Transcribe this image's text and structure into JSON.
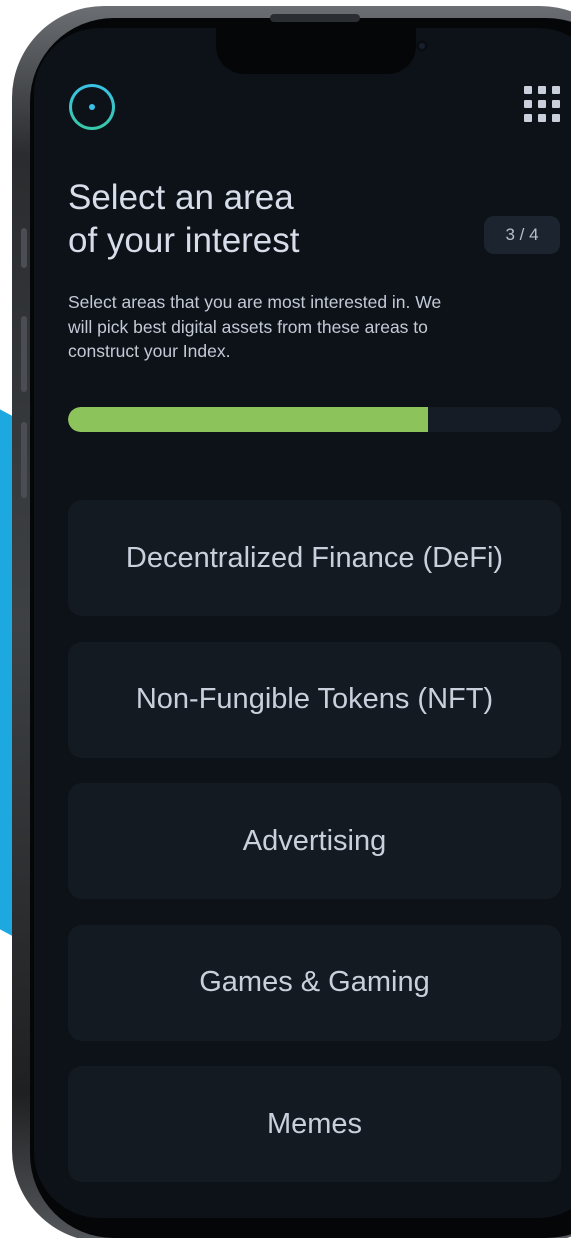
{
  "header": {
    "logo_icon": "app-logo-ring-icon",
    "menu_icon": "grid-menu-icon"
  },
  "page": {
    "title_line1": "Select an area",
    "title_line2": "of your interest",
    "step_indicator": "3 / 4",
    "description": "Select areas that you are most interested in. We will pick best digital assets from these areas to construct your Index."
  },
  "progress": {
    "fraction": 0.73,
    "color": "#8cc35b"
  },
  "options": [
    {
      "label": "Decentralized Finance (DeFi)"
    },
    {
      "label": "Non-Fungible Tokens (NFT)"
    },
    {
      "label": "Advertising"
    },
    {
      "label": "Games & Gaming"
    },
    {
      "label": "Memes"
    }
  ],
  "colors": {
    "screen_background": "#0d1219",
    "card_background": "#141a22",
    "text": "#c9d0dc",
    "accent_cyan": "#3bc1e6",
    "accent_green": "#8cc35b",
    "backdrop_blue": "#1da9e0"
  }
}
